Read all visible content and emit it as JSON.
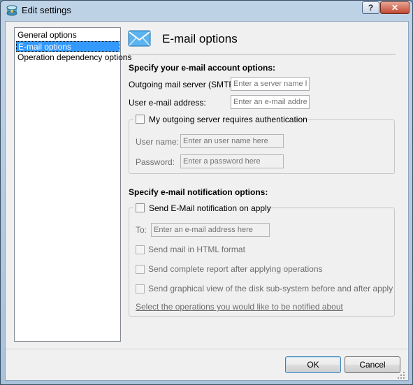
{
  "window": {
    "title": "Edit settings",
    "help_glyph": "?",
    "close_glyph": "✕"
  },
  "nav": {
    "items": [
      "General options",
      "E-mail options",
      "Operation dependency options"
    ],
    "selected": 1
  },
  "header": {
    "title": "E-mail options",
    "icon": "envelope-icon"
  },
  "account": {
    "heading": "Specify your e-mail account options:",
    "smtp_label": "Outgoing mail server (SMTP):",
    "smtp_placeholder": "Enter a server name he",
    "email_label": "User e-mail address:",
    "email_placeholder": "Enter an e-mail address",
    "auth_label": "My outgoing server requires authentication",
    "user_label": "User name:",
    "user_placeholder": "Enter an user name here",
    "password_label": "Password:",
    "password_placeholder": "Enter a password here"
  },
  "notification": {
    "heading": "Specify e-mail notification options:",
    "send_label": "Send E-Mail notification on apply",
    "to_label": "To:",
    "to_placeholder": "Enter an e-mail address here",
    "html_label": "Send mail in HTML format",
    "report_label": "Send complete report after applying operations",
    "graphical_label": "Send graphical view of the disk sub-system before and after apply",
    "ops_link": "Select the operations you would like to be notified about"
  },
  "buttons": {
    "ok": "OK",
    "cancel": "Cancel"
  },
  "colors": {
    "selection": "#3399ff",
    "envelope": "#2b8fd9"
  }
}
